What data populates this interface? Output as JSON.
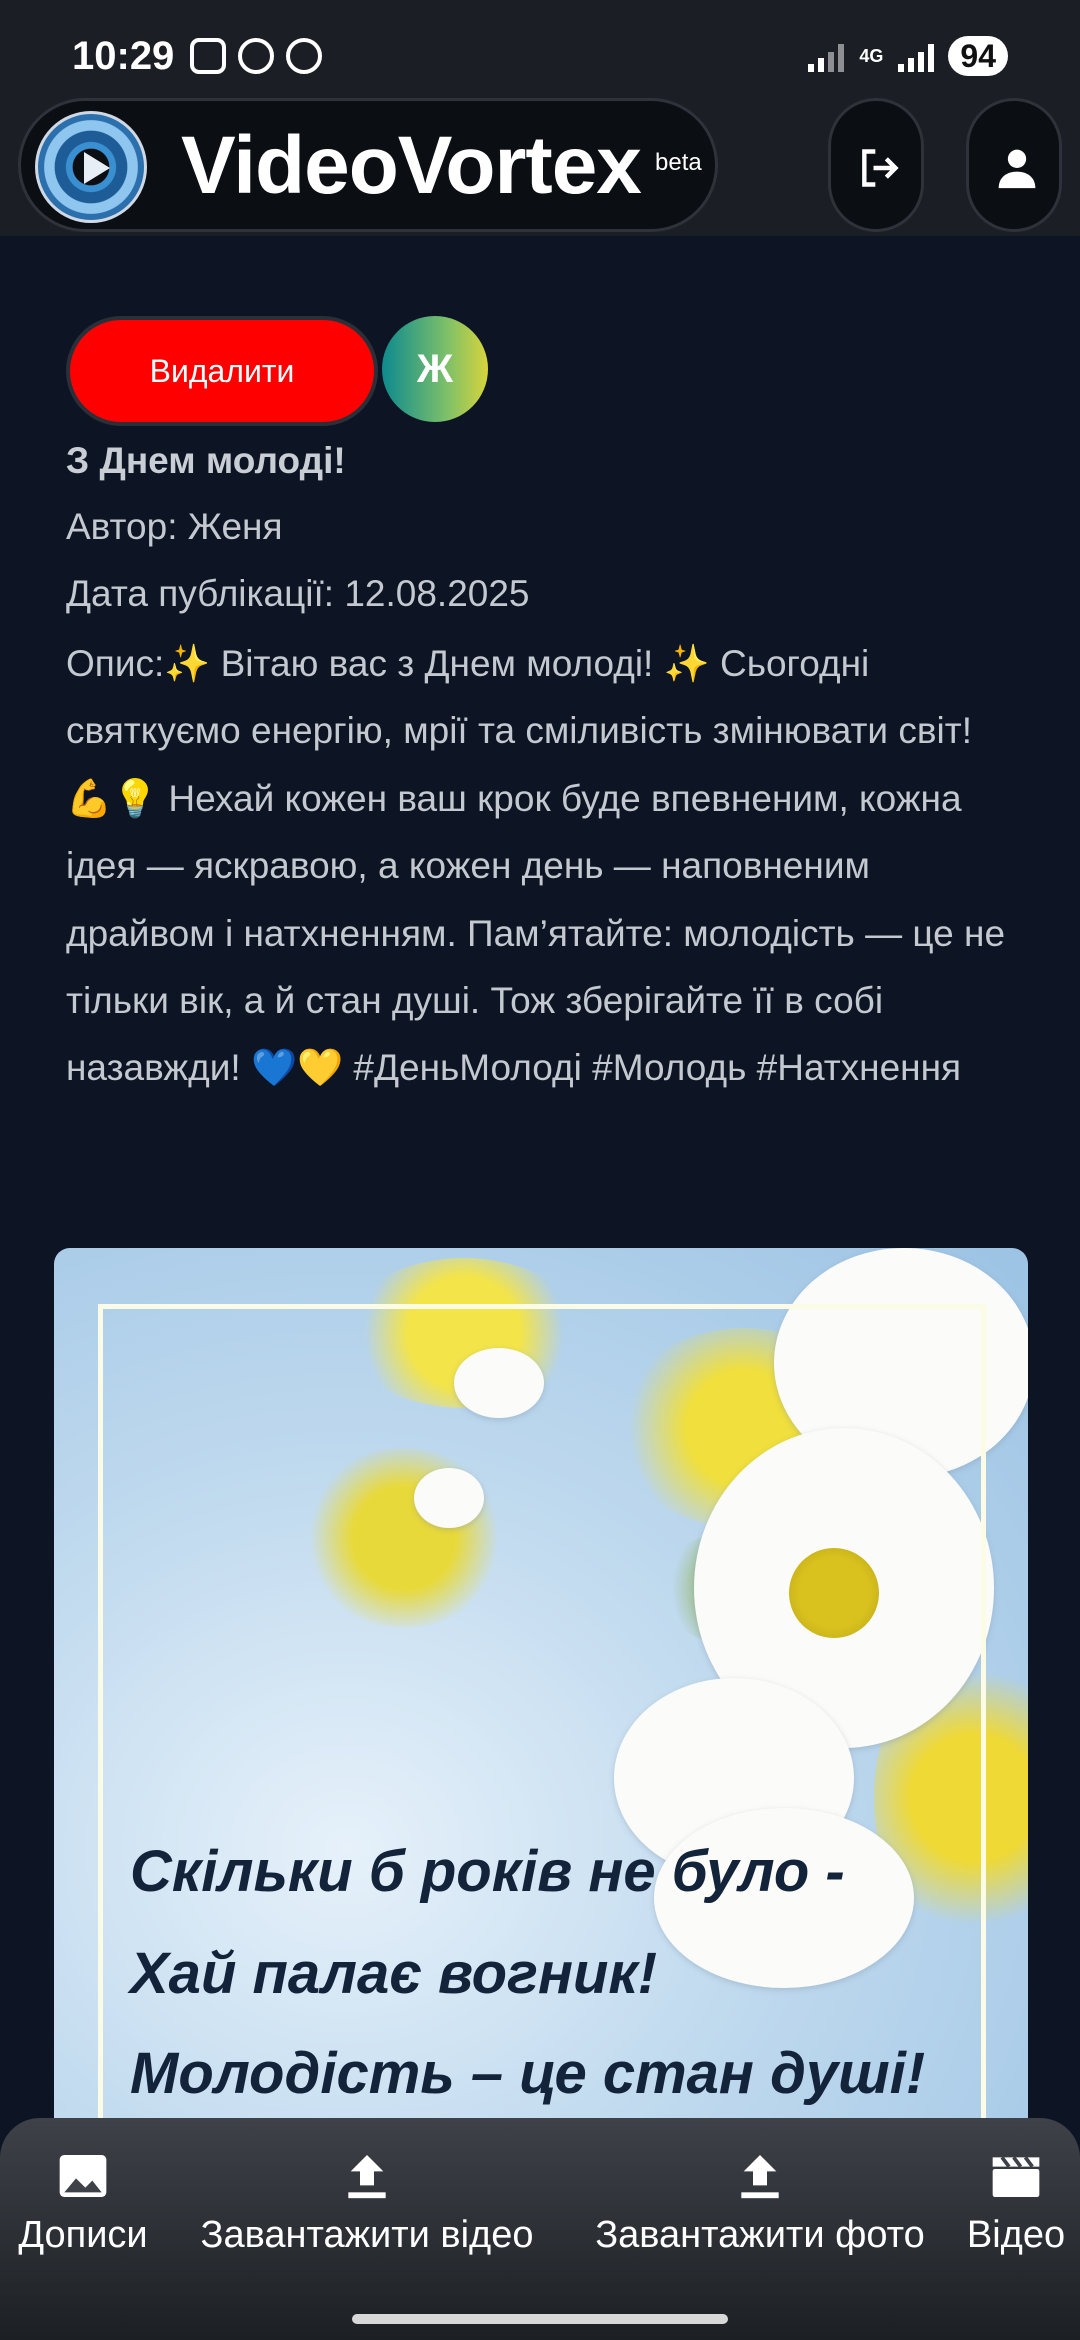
{
  "status_bar": {
    "time": "10:29",
    "network": "4G",
    "battery": "94"
  },
  "header": {
    "app_name": "VideoVortex",
    "badge": "beta"
  },
  "post": {
    "delete_label": "Видалити",
    "author_initial": "Ж",
    "title": "З Днем молоді!",
    "author": "Автор: Женя",
    "date": "Дата публікації: 12.08.2025",
    "description": "Опис:✨ Вітаю вас з Днем молоді! ✨ Сьогодні святкуємо енергію, мрії та сміливість змінювати світ! 💪💡 Нехай кожен ваш крок буде впевненим, кожна ідея — яскравою, а кожен день — наповненим драйвом і натхненням. Пам’ятайте: молодість — це не тільки вік, а й стан душі. Тож зберігайте її в собі назавжди! 💙💛 #ДеньМолоді #Молодь #Натхнення",
    "image_text": {
      "line1": "Скільки б років не було -",
      "line2": "Хай палає вогник!",
      "line3": "Молодість – це стан душі!"
    }
  },
  "bottom_nav": [
    {
      "label": "Дописи",
      "icon": "image-icon"
    },
    {
      "label": "Завантажити відео",
      "icon": "upload-icon"
    },
    {
      "label": "Завантажити фото",
      "icon": "upload-icon"
    },
    {
      "label": "Відео",
      "icon": "clapperboard-icon"
    }
  ]
}
